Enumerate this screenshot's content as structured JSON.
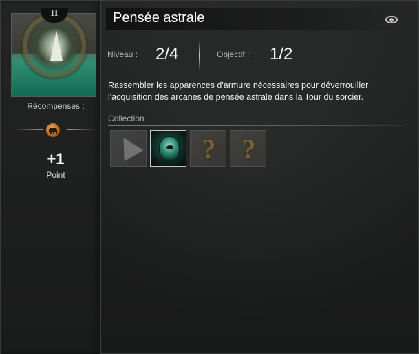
{
  "achievement": {
    "tier_numeral": "II",
    "title": "Pensée astrale",
    "icon_name": "astral-thought-achievement-icon"
  },
  "rewards": {
    "label": "Récompenses :",
    "icon": "achievement-points-icon",
    "points_value": "+1",
    "points_label": "Point"
  },
  "stats": {
    "level_label": "Niveau :",
    "level_value": "2/4",
    "objective_label": "Objectif :",
    "objective_value": "1/2"
  },
  "description": "Rassembler les apparences d'armure nécessaires pour déverrouiller l'acquisition des arcanes de pensée astrale dans la Tour du sorcier.",
  "collection": {
    "label": "Collection",
    "items": [
      {
        "name": "glove-armor-icon",
        "state": "dim"
      },
      {
        "name": "mask-armor-icon",
        "state": "unlocked"
      },
      {
        "name": "unknown-item-icon",
        "state": "unknown",
        "glyph": "?"
      },
      {
        "name": "unknown-item-icon",
        "state": "unknown",
        "glyph": "?"
      }
    ]
  },
  "colors": {
    "background": "#1b1c1c",
    "accent_green": "#0e6a52",
    "reward_orange": "#b86b22",
    "unknown_gold": "#8f6d3a"
  }
}
